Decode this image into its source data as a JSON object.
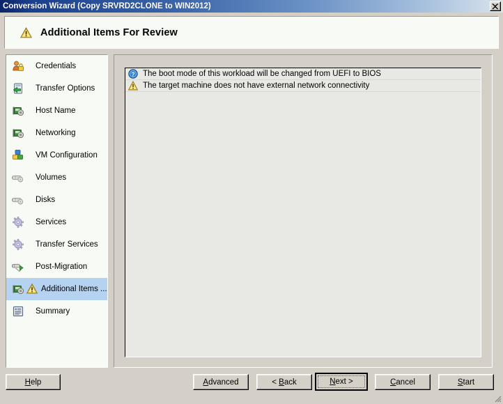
{
  "window": {
    "title": "Conversion Wizard (Copy SRVRD2CLONE to WIN2012)",
    "close_label": "close-icon"
  },
  "header": {
    "icon": "warning-triangle-icon",
    "title": "Additional Items For Review"
  },
  "sidebar": {
    "items": [
      {
        "label": "Credentials",
        "icon": "credentials-icon",
        "selected": false,
        "warning": false
      },
      {
        "label": "Transfer Options",
        "icon": "transfer-options-icon",
        "selected": false,
        "warning": false
      },
      {
        "label": "Host Name",
        "icon": "host-name-icon",
        "selected": false,
        "warning": false
      },
      {
        "label": "Networking",
        "icon": "networking-icon",
        "selected": false,
        "warning": false
      },
      {
        "label": "VM Configuration",
        "icon": "vm-configuration-icon",
        "selected": false,
        "warning": false
      },
      {
        "label": "Volumes",
        "icon": "volumes-icon",
        "selected": false,
        "warning": false
      },
      {
        "label": "Disks",
        "icon": "disks-icon",
        "selected": false,
        "warning": false
      },
      {
        "label": "Services",
        "icon": "services-icon",
        "selected": false,
        "warning": false
      },
      {
        "label": "Transfer Services",
        "icon": "transfer-services-icon",
        "selected": false,
        "warning": false
      },
      {
        "label": "Post-Migration",
        "icon": "post-migration-icon",
        "selected": false,
        "warning": false
      },
      {
        "label": "Additional Items ...",
        "icon": "additional-items-icon",
        "selected": true,
        "warning": true
      },
      {
        "label": "Summary",
        "icon": "summary-icon",
        "selected": false,
        "warning": false
      }
    ]
  },
  "review_list": {
    "items": [
      {
        "icon": "info-icon",
        "text": "The boot mode of this workload will be changed from UEFI to BIOS"
      },
      {
        "icon": "warning-icon",
        "text": "The target machine does not have external network connectivity"
      }
    ]
  },
  "buttons": {
    "help": {
      "prefix": "",
      "mnemonic": "H",
      "suffix": "elp"
    },
    "advanced": {
      "prefix": "",
      "mnemonic": "A",
      "suffix": "dvanced"
    },
    "back": {
      "prefix": "< ",
      "mnemonic": "B",
      "suffix": "ack"
    },
    "next": {
      "prefix": "",
      "mnemonic": "N",
      "suffix": "ext >"
    },
    "cancel": {
      "prefix": "",
      "mnemonic": "C",
      "suffix": "ancel"
    },
    "start": {
      "prefix": "",
      "mnemonic": "S",
      "suffix": "tart"
    }
  },
  "colors": {
    "title_start": "#0a246a",
    "title_end": "#cfdcea",
    "face": "#d4d0c8",
    "panel": "#f7faf5",
    "selection": "#b5d3f0",
    "list_bg": "#e8e8e4",
    "warning_yellow": "#f5c518",
    "info_blue": "#2f7fd0"
  }
}
